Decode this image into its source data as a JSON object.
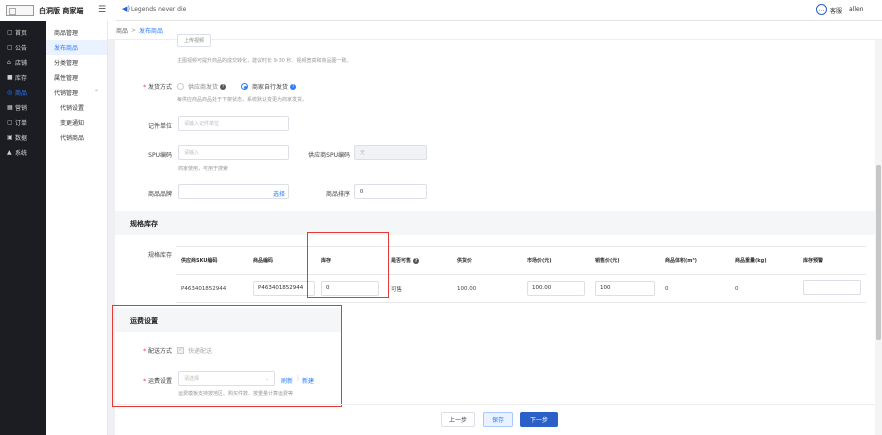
{
  "topbar": {
    "brand": "白洞版 商家端",
    "slogan": "Legends never die",
    "kefu": "客服",
    "user": "allen"
  },
  "sidebar": [
    {
      "icon": "home-icon",
      "glyph": "▢",
      "label": "首页"
    },
    {
      "icon": "notice-icon",
      "glyph": "▢",
      "label": "公告"
    },
    {
      "icon": "store-icon",
      "glyph": "⌂",
      "label": "店铺"
    },
    {
      "icon": "inventory-icon",
      "glyph": "■",
      "label": "库存"
    },
    {
      "icon": "goods-icon",
      "glyph": "◎",
      "label": "商品"
    },
    {
      "icon": "marketing-icon",
      "glyph": "▦",
      "label": "营销"
    },
    {
      "icon": "order-icon",
      "glyph": "▢",
      "label": "订单"
    },
    {
      "icon": "data-icon",
      "glyph": "▣",
      "label": "数据"
    },
    {
      "icon": "system-icon",
      "glyph": "▲",
      "label": "系统"
    }
  ],
  "subnav": [
    {
      "label": "商品管理"
    },
    {
      "label": "发布商品"
    },
    {
      "label": "分类管理"
    },
    {
      "label": "属性管理"
    },
    {
      "label": "代销管理"
    },
    {
      "label": "代销设置"
    },
    {
      "label": "变更通知"
    },
    {
      "label": "代销商品"
    }
  ],
  "breadcrumb": {
    "root": "商品",
    "current": "发布商品"
  },
  "upload": {
    "button_label": "上传视频",
    "hint": "主图视频可提升商品的成交转化，建议时长 9-30 秒、视频宽高和商品图一致。"
  },
  "shipping": {
    "label": "发货方式",
    "option_supplier": "供应商发货",
    "option_merchant": "商家自行发货",
    "hint": "每供应商品商品处于下架状态，系统默认变更为商家发货。"
  },
  "unit": {
    "label": "记件单位",
    "placeholder": "请输入记件单位"
  },
  "spu": {
    "label": "SPU编码",
    "placeholder": "请输入",
    "hint": "商家使用，可用于搜索",
    "supplier_label": "供应商SPU编码",
    "supplier_value": "无"
  },
  "brand": {
    "label": "商品品牌",
    "select_label": "选择",
    "sort_label": "商品排序",
    "sort_value": "0"
  },
  "spec": {
    "section_title": "规格库存",
    "row_label": "规格库存",
    "columns": [
      "供应商SKU编码",
      "商品编码",
      "库存",
      "是否可售",
      "供货价",
      "市场价(元)",
      "销售价(元)",
      "商品体积(m³)",
      "商品重量(kg)",
      "库存预警"
    ],
    "rows": [
      [
        "P463401852944",
        "P463401852944",
        "0",
        "可售",
        "100.00",
        "100.00",
        "100",
        "0",
        "0",
        ""
      ]
    ]
  },
  "freight": {
    "section_title": "运费设置",
    "delivery_label": "配送方式",
    "delivery_option": "快递配送",
    "template_label": "运费设置",
    "template_placeholder": "请选择",
    "refresh": "刷新",
    "new": "新建",
    "hint": "运费模板支持按地区、购买件数、按重量计算运费等"
  },
  "footer": {
    "prev": "上一步",
    "save": "保存",
    "next": "下一步"
  }
}
